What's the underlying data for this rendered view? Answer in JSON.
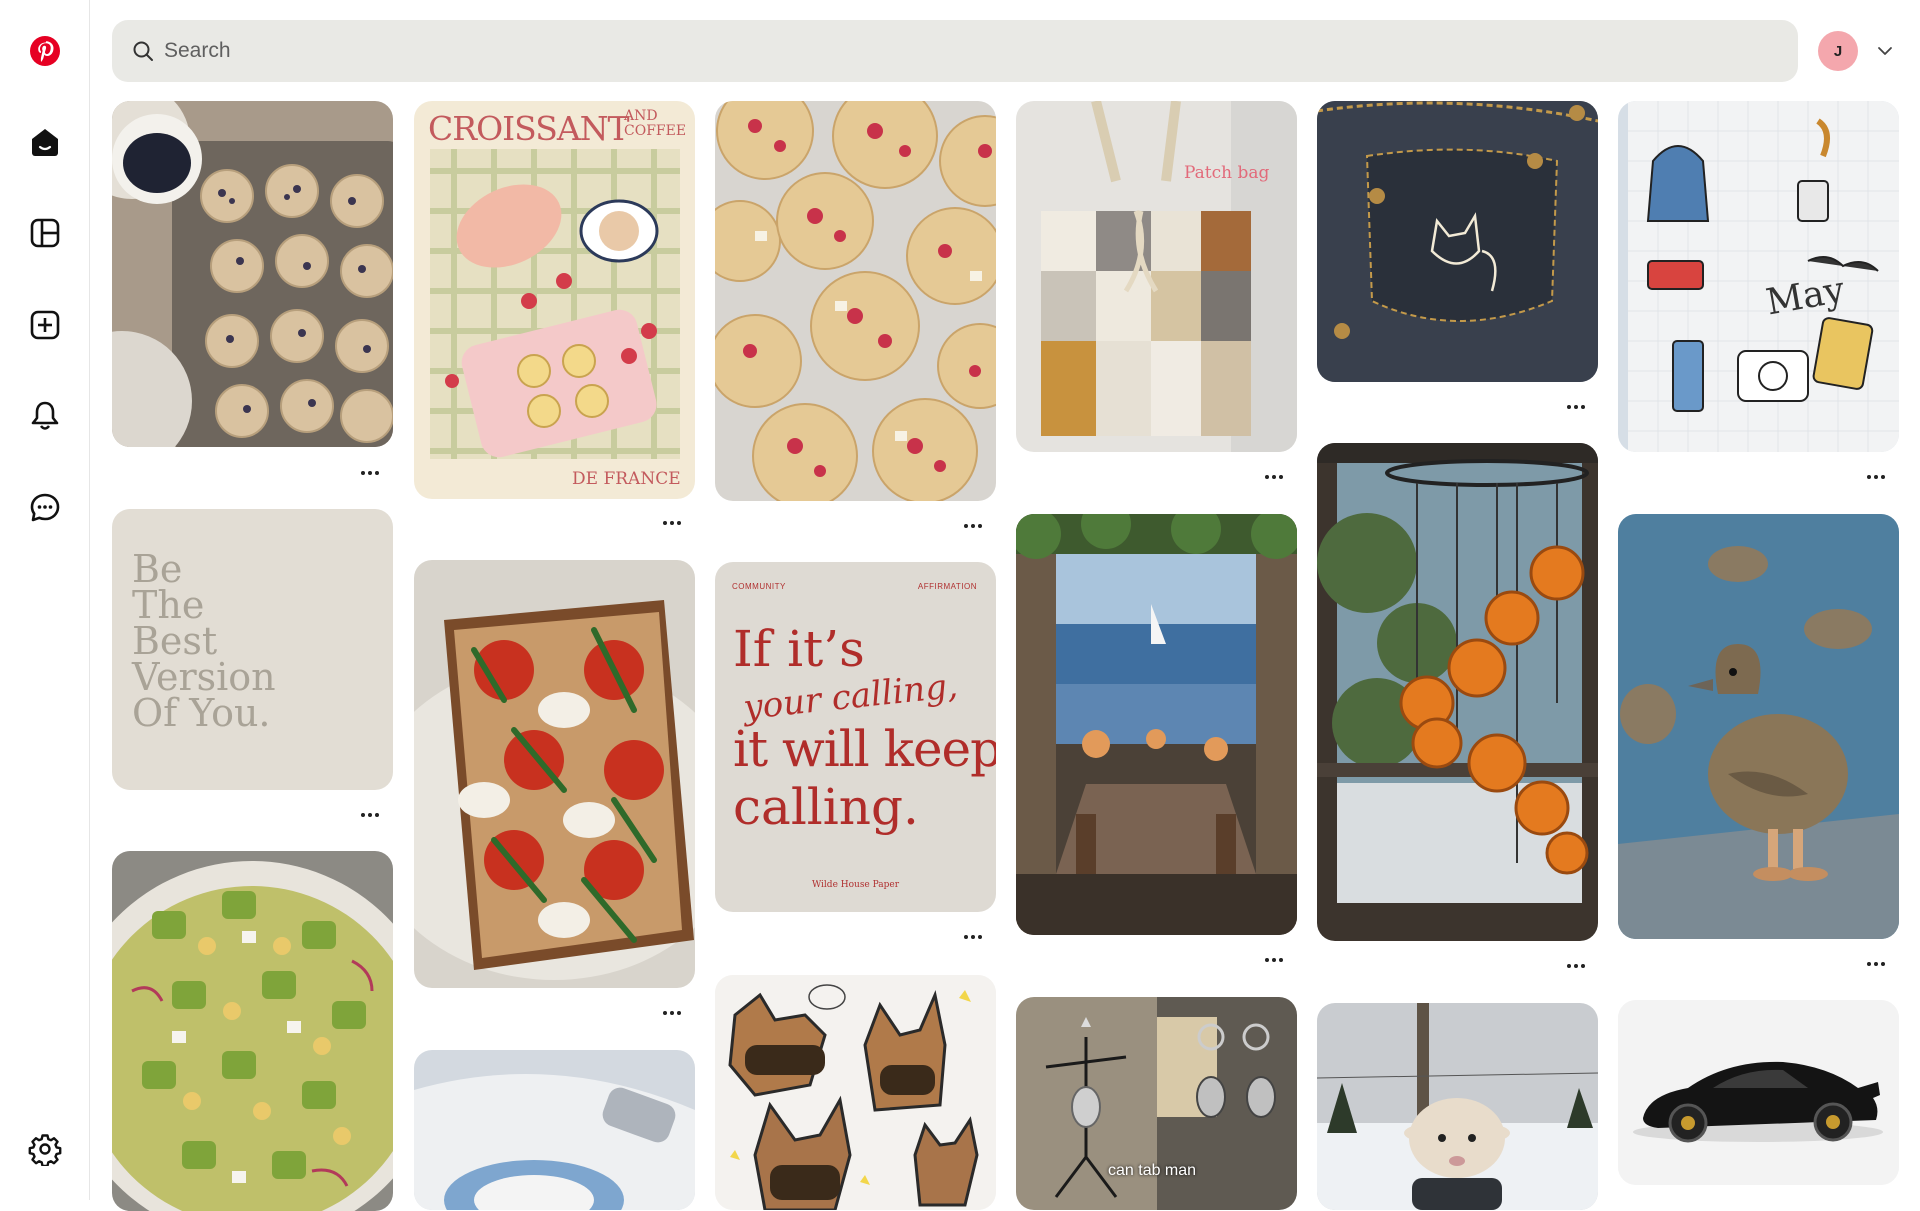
{
  "app": {
    "brand": "Pinterest",
    "brand_color": "#e60023"
  },
  "sidebar": {
    "items": [
      {
        "name": "pinterest-logo-icon"
      },
      {
        "name": "home-icon"
      },
      {
        "name": "boards-icon"
      },
      {
        "name": "create-icon"
      },
      {
        "name": "notifications-icon"
      },
      {
        "name": "messages-icon"
      },
      {
        "name": "settings-icon"
      }
    ]
  },
  "header": {
    "search_placeholder": "Search",
    "avatar_initial": "J",
    "avatar_color": "#f4a7ad"
  },
  "pins": {
    "croissant": {
      "title": "CROISSANT",
      "title_small": "AND COFFEE",
      "footer": "DE FRANCE"
    },
    "patch_bag": {
      "caption": "Patch bag"
    },
    "notebook": {
      "month": "May"
    },
    "quote": {
      "lines": [
        "Be",
        "The",
        "Best",
        "Version",
        "Of You."
      ]
    },
    "affirmation": {
      "tag_left": "COMMUNITY",
      "tag_right": "AFFIRMATION",
      "line1": "If it’s",
      "script": "your calling,",
      "line2": "it will keep",
      "line3": "calling.",
      "credit": "Wilde House Paper"
    },
    "tab_man": {
      "caption": "can tab man"
    }
  },
  "more_label": "More options"
}
